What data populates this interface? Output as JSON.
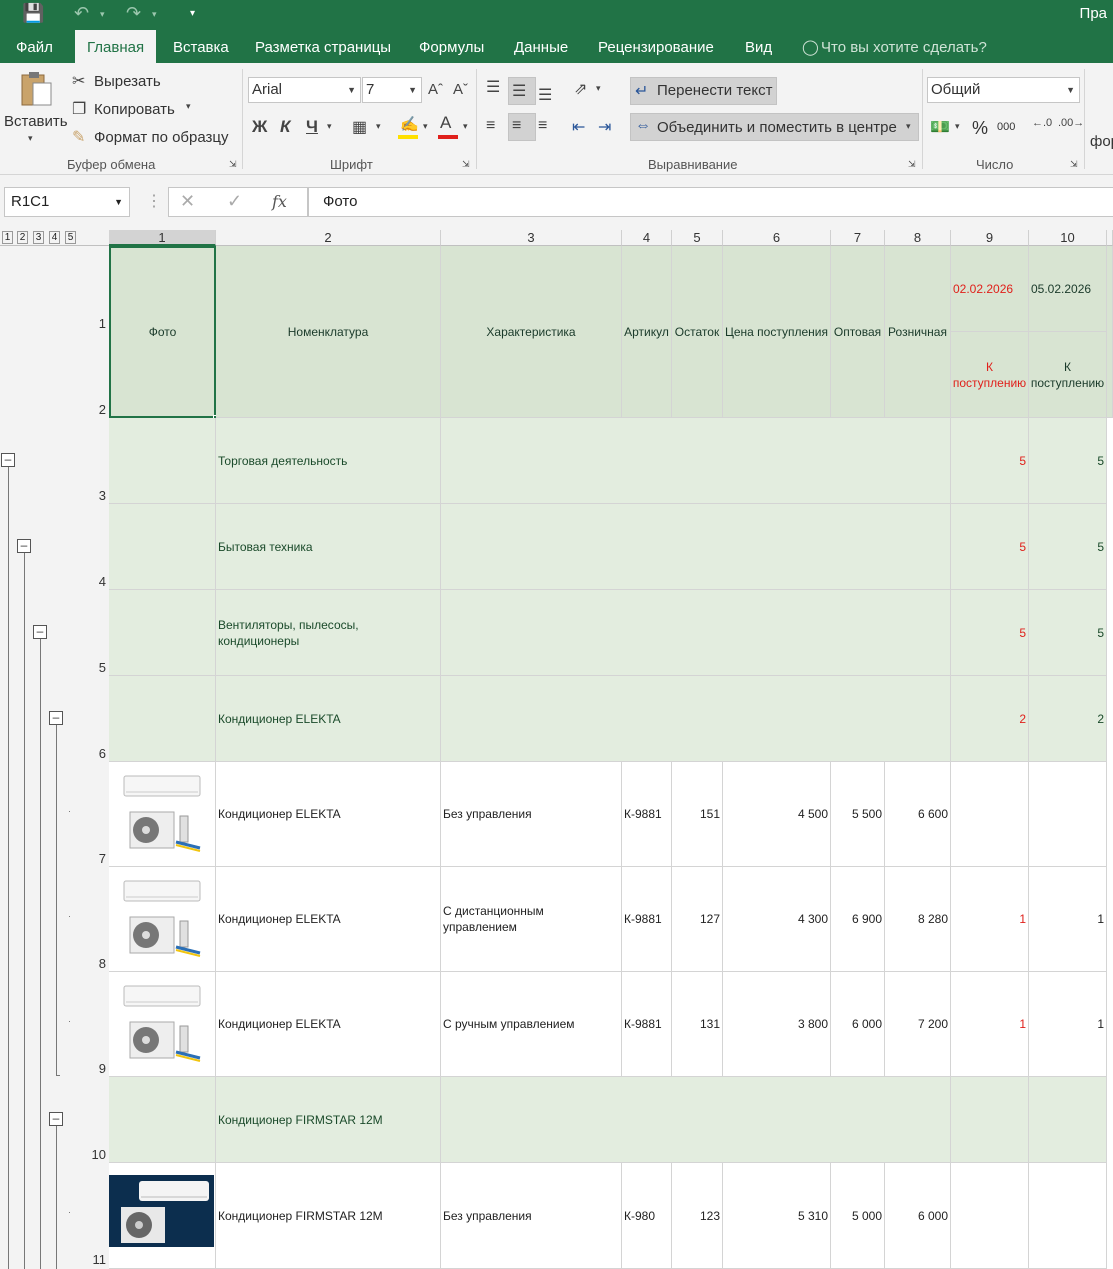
{
  "app": {
    "title_partial": "Пра"
  },
  "tabs": [
    "Файл",
    "Главная",
    "Вставка",
    "Разметка страницы",
    "Формулы",
    "Данные",
    "Рецензирование",
    "Вид"
  ],
  "tell_me": "Что вы хотите сделать?",
  "ribbon": {
    "clipboard": {
      "paste": "Вставить",
      "cut": "Вырезать",
      "copy": "Копировать",
      "format_painter": "Формат по образцу",
      "group_label": "Буфер обмена"
    },
    "font": {
      "name": "Arial",
      "size": "7",
      "bold": "Ж",
      "italic": "К",
      "underline": "Ч",
      "group_label": "Шрифт",
      "fill_color": "#ffe000",
      "font_color": "#e0201b"
    },
    "alignment": {
      "wrap_text": "Перенести текст",
      "merge_center": "Объединить и поместить в центре",
      "group_label": "Выравнивание"
    },
    "number": {
      "format": "Общий",
      "percent": "%",
      "thousands": "000",
      "group_label": "Число"
    },
    "styles_partial": "фор"
  },
  "formula_bar": {
    "name_box": "R1C1",
    "fx": "fx",
    "value": "Фото"
  },
  "outline_levels": [
    "1",
    "2",
    "3",
    "4",
    "5"
  ],
  "columns": [
    "1",
    "2",
    "3",
    "4",
    "5",
    "6",
    "7",
    "8",
    "9",
    "10"
  ],
  "header": {
    "photo": "Фото",
    "nomenclature": "Номенклатура",
    "characteristic": "Характеристика",
    "article": "Артикул",
    "stock": "Остаток",
    "purchase_price": "Цена поступления",
    "wholesale": "Оптовая",
    "retail": "Розничная",
    "date1": "02.02.2026",
    "date2": "05.02.2026",
    "incoming1": "К поступлению",
    "incoming2": "К поступлению"
  },
  "row_numbers": [
    "1",
    "2",
    "3",
    "4",
    "5",
    "6",
    "7",
    "8",
    "9",
    "10",
    "11"
  ],
  "rows": [
    {
      "name": "Торговая деятельность",
      "c9": "5",
      "c10": "5"
    },
    {
      "name": "Бытовая техника",
      "c9": "5",
      "c10": "5"
    },
    {
      "name": "Вентиляторы, пылесосы, кондиционеры",
      "c9": "5",
      "c10": "5"
    },
    {
      "name": "Кондиционер ELEKTA",
      "c9": "2",
      "c10": "2"
    },
    {
      "name": "Кондиционер ELEKTA",
      "char": "Без управления",
      "art": "К-9881",
      "stock": "151",
      "price": "4 500",
      "opt": "5 500",
      "retail": "6 600",
      "c9": "",
      "c10": ""
    },
    {
      "name": "Кондиционер ELEKTA",
      "char": "С дистанционным управлением",
      "art": "К-9881",
      "stock": "127",
      "price": "4 300",
      "opt": "6 900",
      "retail": "8 280",
      "c9": "1",
      "c10": "1"
    },
    {
      "name": "Кондиционер ELEKTA",
      "char": "С ручным управлением",
      "art": "К-9881",
      "stock": "131",
      "price": "3 800",
      "opt": "6 000",
      "retail": "7 200",
      "c9": "1",
      "c10": "1"
    },
    {
      "name": "Кондиционер FIRMSTAR 12M",
      "c9": "",
      "c10": ""
    },
    {
      "name": "Кондиционер FIRMSTAR 12M",
      "char": "Без управления",
      "art": "К-980",
      "stock": "123",
      "price": "5 310",
      "opt": "5 000",
      "retail": "6 000",
      "c9": "",
      "c10": ""
    }
  ]
}
